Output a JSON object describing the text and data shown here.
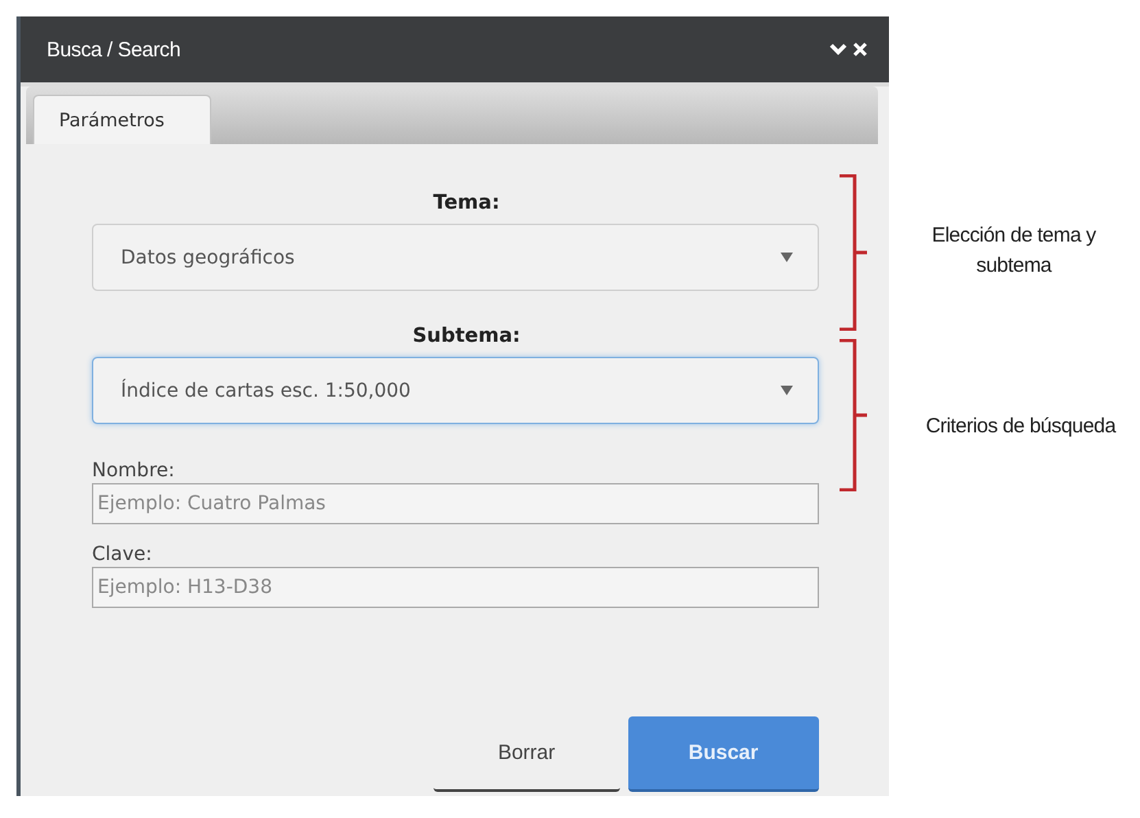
{
  "window": {
    "title": "Busca / Search"
  },
  "tabs": [
    {
      "label": "Parámetros",
      "selected": true
    }
  ],
  "fields": [
    {
      "kind": "select",
      "label": "Tema:",
      "value": "Datos geográficos",
      "focused": false
    },
    {
      "kind": "select",
      "label": "Subtema:",
      "value": "Índice de cartas esc. 1:50,000",
      "focused": true
    },
    {
      "kind": "text",
      "label": "Nombre:",
      "placeholder": "Ejemplo: Cuatro Palmas"
    },
    {
      "kind": "text",
      "label": "Clave:",
      "placeholder": "Ejemplo: H13-D38"
    }
  ],
  "buttons": [
    {
      "label": "Borrar",
      "kind": "secondary"
    },
    {
      "label": "Buscar",
      "kind": "primary"
    }
  ],
  "annotations": [
    {
      "text": "Elección de tema y subtema"
    },
    {
      "text": "Criterios de búsqueda"
    }
  ]
}
